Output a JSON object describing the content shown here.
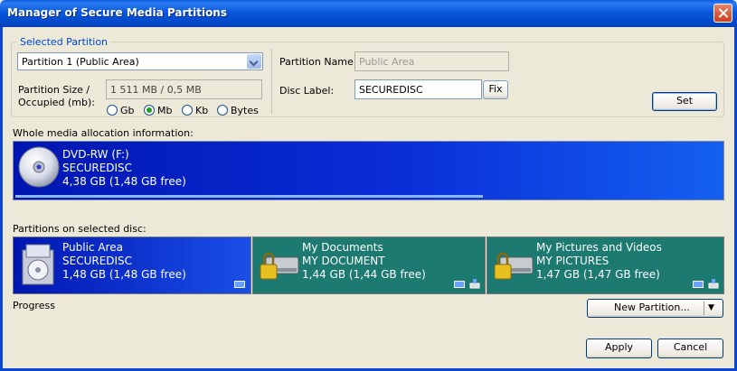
{
  "window": {
    "title": "Manager of Secure Media Partitions"
  },
  "selected_partition": {
    "group_label": "Selected Partition",
    "combo_value": "Partition 1 (Public Area)",
    "size_label_1": "Partition Size /",
    "size_label_2": "Occupied (mb):",
    "size_value": "1 511 MB / 0,5 MB",
    "units": [
      "Gb",
      "Mb",
      "Kb",
      "Bytes"
    ],
    "selected_unit": "Mb",
    "name_label": "Partition Name:",
    "name_value": "Public Area",
    "disc_label_label": "Disc Label:",
    "disc_label_value": "SECUREDISC",
    "fix_label": "Fix",
    "set_label": "Set"
  },
  "media": {
    "section_label": "Whole media allocation information:",
    "line1": "DVD-RW (F:)",
    "line2": "SECUREDISC",
    "line3": "4,38 GB (1,48 GB free)",
    "fill_fraction": 0.66
  },
  "partitions_label": "Partitions on selected disc:",
  "partitions": [
    {
      "title": "Public Area",
      "label": "SECUREDISC",
      "size": "1,48 GB (1,48 GB free)",
      "icon": "public-area-icon"
    },
    {
      "title": "My Documents",
      "label": "MY DOCUMENT",
      "size": "1,44 GB (1,44 GB free)",
      "icon": "locked-drive-icon"
    },
    {
      "title": "My Pictures and Videos",
      "label": "MY PICTURES",
      "size": "1,47 GB (1,47 GB free)",
      "icon": "locked-drive-icon"
    }
  ],
  "progress_label": "Progress",
  "buttons": {
    "new_partition": "New Partition...",
    "apply": "Apply",
    "cancel": "Cancel"
  },
  "colors": {
    "accent": "#0046d5",
    "titlebar": "#0a58dc",
    "partition_selected": "#0a2ed8",
    "partition_other": "#1c7a70"
  }
}
